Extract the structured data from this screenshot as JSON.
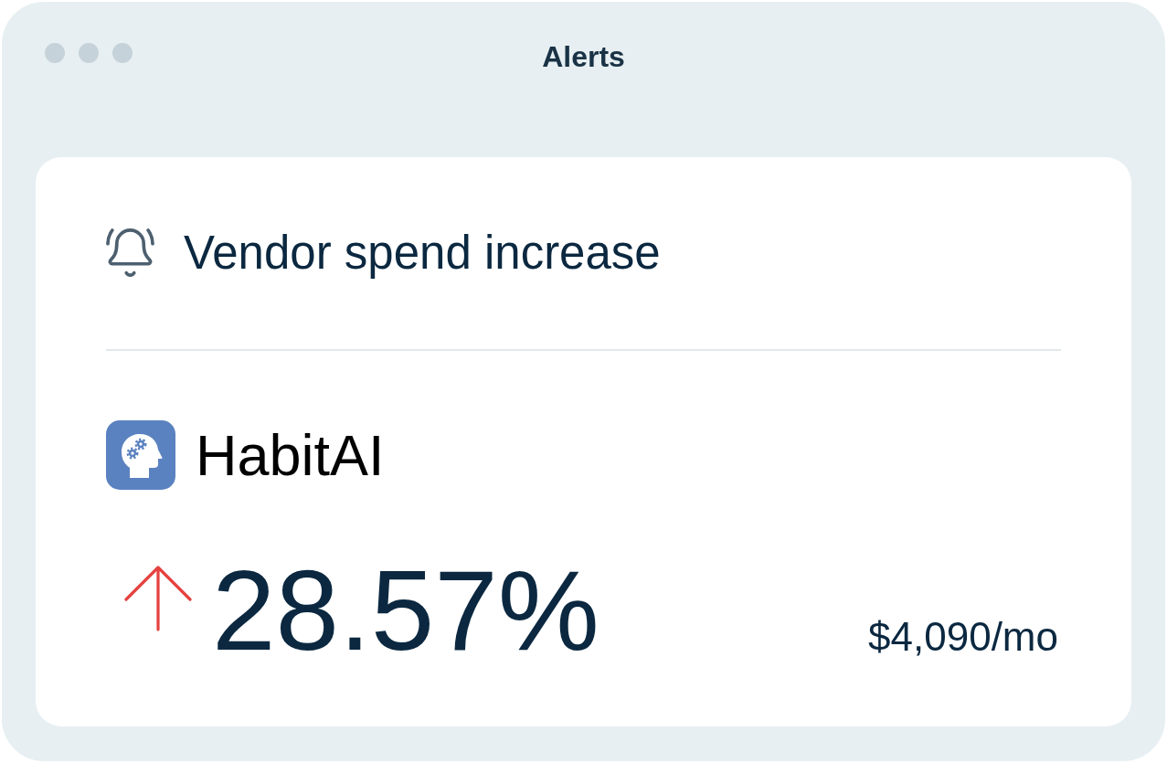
{
  "window": {
    "title": "Alerts"
  },
  "alert": {
    "title": "Vendor spend increase"
  },
  "vendor": {
    "name": "HabitAI"
  },
  "change": {
    "rising": true,
    "value": "28.57%",
    "amount": "$4,090/mo"
  }
}
